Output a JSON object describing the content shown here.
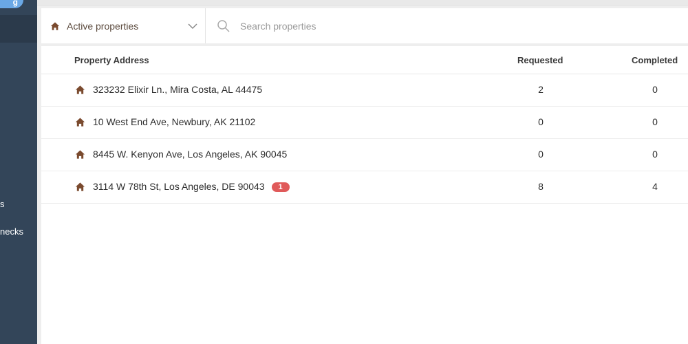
{
  "sidebar": {
    "top_pill_label": "g",
    "items": [
      {
        "label": "s"
      },
      {
        "label": "necks"
      }
    ]
  },
  "toolbar": {
    "filter_label": "Active properties",
    "search_placeholder": "Search properties",
    "search_value": ""
  },
  "table": {
    "headers": {
      "address": "Property Address",
      "requested": "Requested",
      "completed": "Completed"
    },
    "rows": [
      {
        "address": "323232 Elixir Ln., Mira Costa, AL 44475",
        "requested": "2",
        "completed": "0",
        "badge": ""
      },
      {
        "address": "10 West End Ave, Newbury, AK 21102",
        "requested": "0",
        "completed": "0",
        "badge": ""
      },
      {
        "address": "8445 W. Kenyon Ave, Los Angeles, AK 90045",
        "requested": "0",
        "completed": "0",
        "badge": ""
      },
      {
        "address": "3114 W 78th St, Los Angeles, DE 90043",
        "requested": "8",
        "completed": "4",
        "badge": "1"
      }
    ]
  },
  "colors": {
    "sidebar_bg": "#334559",
    "accent_brown": "#7a4a2e",
    "badge_red": "#e05a5a"
  },
  "icons": {
    "property": "home-icon",
    "search": "search-icon",
    "dropdown": "chevron-down-icon"
  }
}
